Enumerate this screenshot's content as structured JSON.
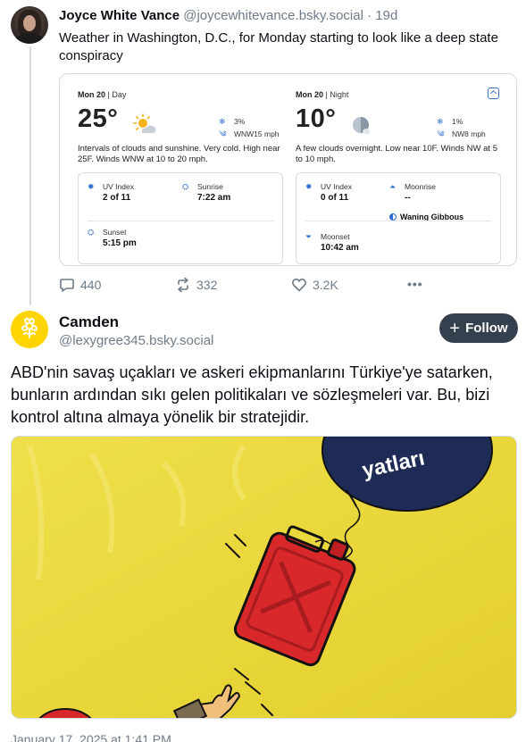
{
  "quoted_post": {
    "author_name": "Joyce White Vance",
    "author_handle": "@joycewhitevance.bsky.social",
    "separator": "·",
    "time_ago": "19d",
    "text": "Weather in Washington, D.C., for Monday starting to look like a deep state conspiracy",
    "weather_card": {
      "day": {
        "period_date": "Mon 20",
        "period_label": "Day",
        "temperature": "25°",
        "precip": "3%",
        "wind": "WNW15 mph",
        "description": "Intervals of clouds and sunshine. Very cold. High near 25F. Winds WNW at 10 to 20 mph.",
        "uv_label": "UV Index",
        "uv_value": "2 of 11",
        "sunrise_label": "Sunrise",
        "sunrise_value": "7:22 am",
        "sunset_label": "Sunset",
        "sunset_value": "5:15 pm"
      },
      "night": {
        "period_date": "Mon 20",
        "period_label": "Night",
        "temperature": "10°",
        "precip": "1%",
        "wind": "NW8 mph",
        "description": "A few clouds overnight. Low near 10F. Winds NW at 5 to 10 mph.",
        "uv_label": "UV Index",
        "uv_value": "0 of 11",
        "moonrise_label": "Moonrise",
        "moonrise_value": "--",
        "moon_phase": "Waning Gibbous",
        "moonset_label": "Moonset",
        "moonset_value": "10:42 am"
      }
    },
    "actions": {
      "replies": "440",
      "reposts": "332",
      "likes": "3.2K",
      "more": "•••"
    }
  },
  "main_post": {
    "author_name": "Camden",
    "author_handle": "@lexygree345.bsky.social",
    "follow_label": "Follow",
    "follow_plus": "+",
    "text": "ABD'nin savaş uçakları ve askeri ekipmanlarını Türkiye'ye satarken, bunların ardından sıkı gelen politikaları ve sözleşmeleri var. Bu, bizi kontrol altına almaya yönelik bir stratejidir.",
    "image_balloon_text": "yatları",
    "date": "January 17, 2025 at 1:41 PM"
  },
  "colors": {
    "accent_blue": "#2f6fd0",
    "follow_bg": "#34404d",
    "muted": "#6f7b88",
    "cartoon_yellow": "#e8d63a"
  }
}
